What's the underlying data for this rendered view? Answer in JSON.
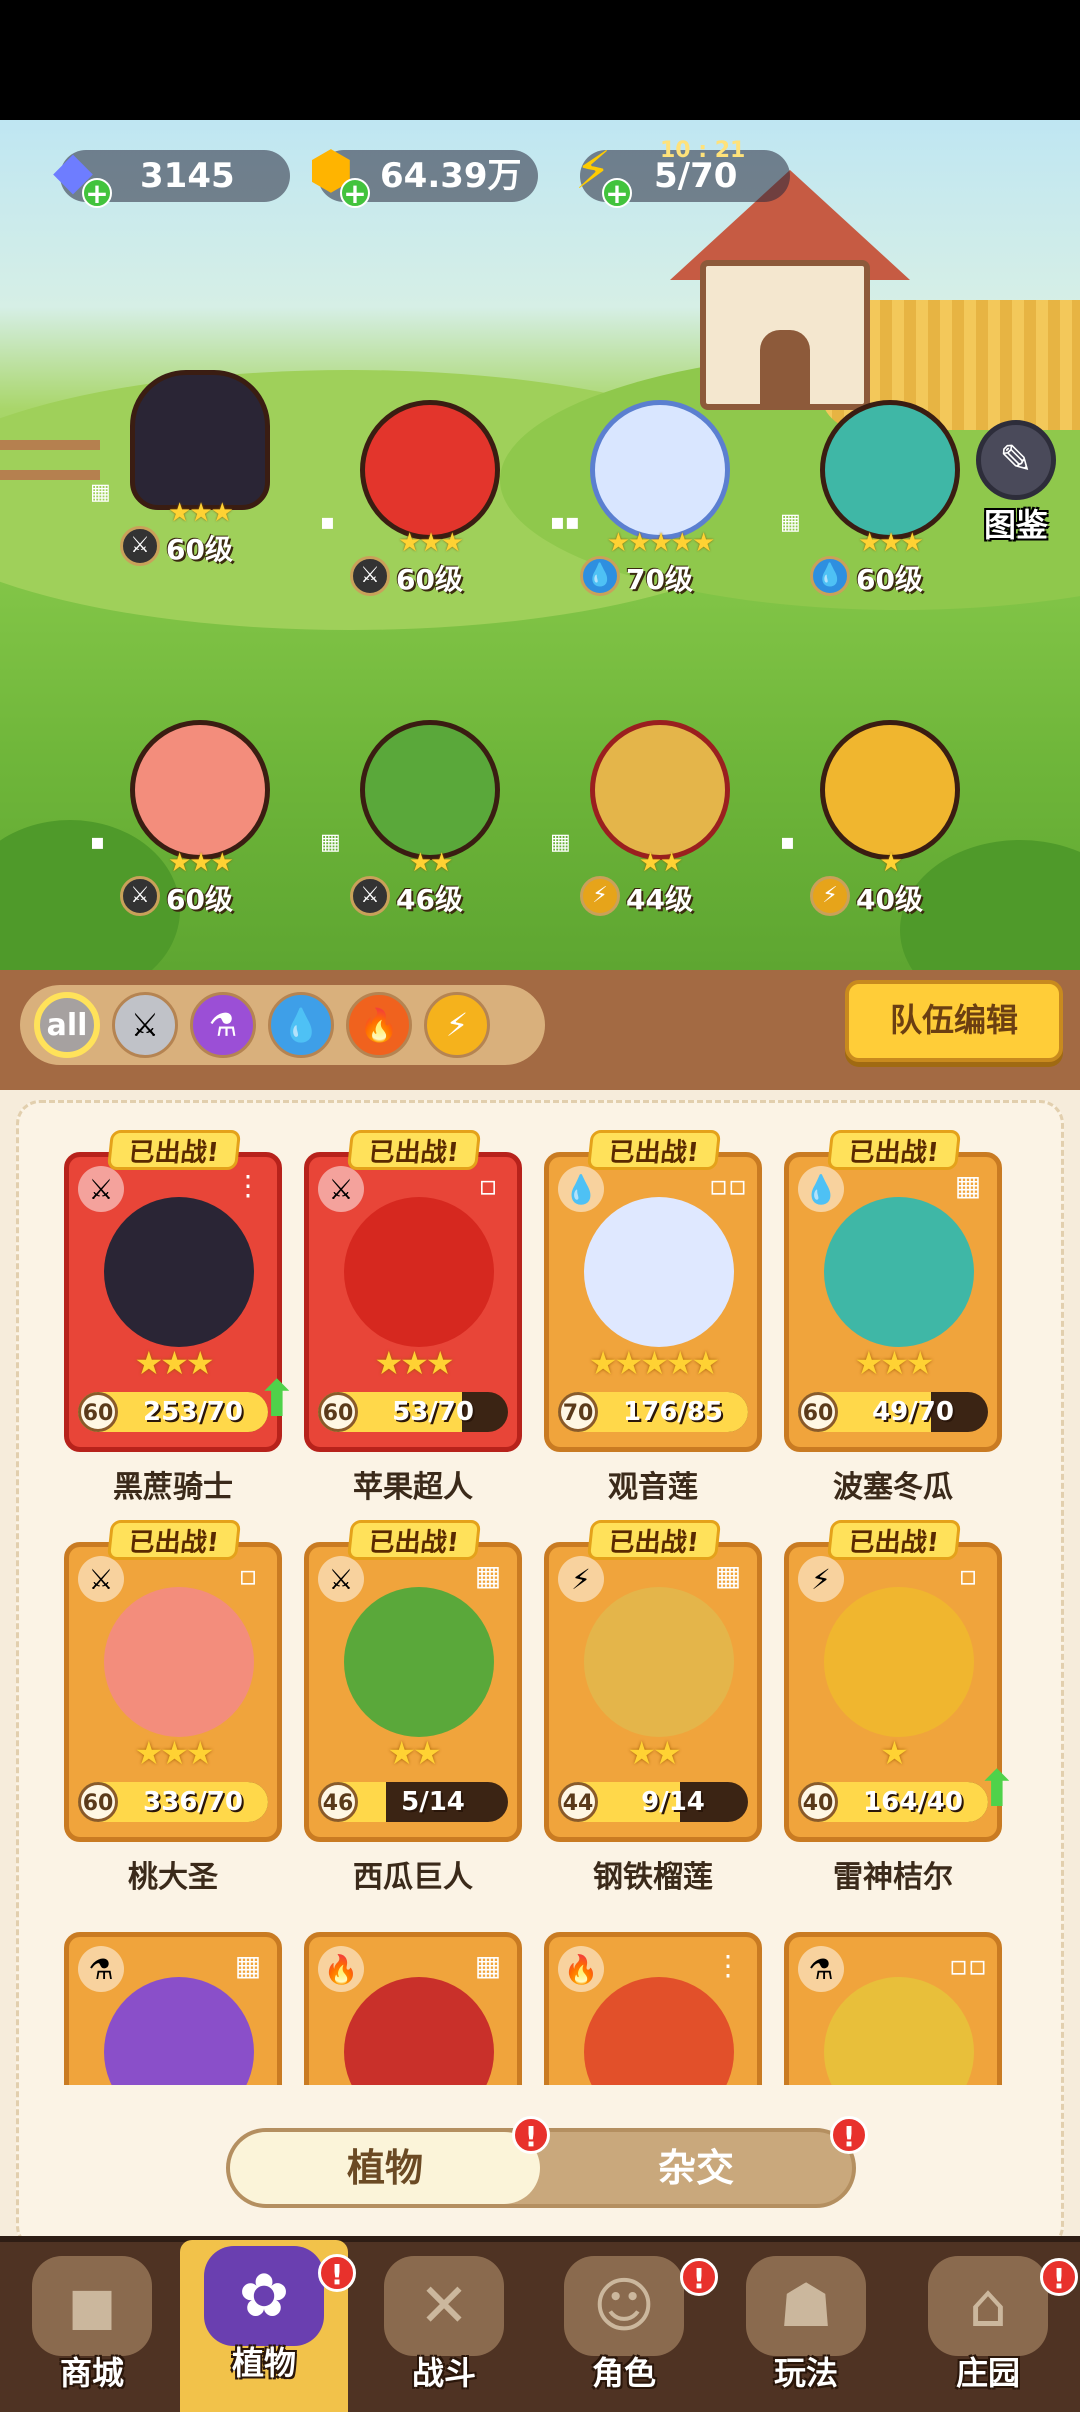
{
  "resources": {
    "gems": "3145",
    "coins": "64.39万",
    "energy": "5/70",
    "energy_timer": "10 : 21"
  },
  "codex_label": "图鉴",
  "field_heroes": [
    {
      "level": "60级",
      "elem": "sword",
      "stars": "★★★"
    },
    {
      "level": "60级",
      "elem": "sword",
      "stars": "★★★"
    },
    {
      "level": "70级",
      "elem": "water",
      "stars": "★★★★★"
    },
    {
      "level": "60级",
      "elem": "water",
      "stars": "★★★"
    },
    {
      "level": "60级",
      "elem": "sword",
      "stars": "★★★"
    },
    {
      "level": "46级",
      "elem": "sword",
      "stars": "★★"
    },
    {
      "level": "44级",
      "elem": "thunder",
      "stars": "★★"
    },
    {
      "level": "40级",
      "elem": "thunder",
      "stars": "★"
    }
  ],
  "filters": [
    "all",
    "sword",
    "poison",
    "water",
    "fire",
    "thunder"
  ],
  "team_edit_label": "队伍编辑",
  "deployed_label": "已出战!",
  "cards": [
    {
      "name": "黑蔗骑士",
      "level": "60",
      "progress": "253/70",
      "stars": "★★★",
      "elem": "sword",
      "upgrade": true
    },
    {
      "name": "苹果超人",
      "level": "60",
      "progress": "53/70",
      "stars": "★★★",
      "elem": "sword",
      "upgrade": false
    },
    {
      "name": "观音莲",
      "level": "70",
      "progress": "176/85",
      "stars": "★★★★★",
      "elem": "water",
      "upgrade": false
    },
    {
      "name": "波塞冬瓜",
      "level": "60",
      "progress": "49/70",
      "stars": "★★★",
      "elem": "water",
      "upgrade": false
    },
    {
      "name": "桃大圣",
      "level": "60",
      "progress": "336/70",
      "stars": "★★★",
      "elem": "sword",
      "upgrade": false
    },
    {
      "name": "西瓜巨人",
      "level": "46",
      "progress": "5/14",
      "stars": "★★",
      "elem": "sword",
      "upgrade": false
    },
    {
      "name": "钢铁榴莲",
      "level": "44",
      "progress": "9/14",
      "stars": "★★",
      "elem": "thunder",
      "upgrade": false
    },
    {
      "name": "雷神桔尔",
      "level": "40",
      "progress": "164/40",
      "stars": "★",
      "elem": "thunder",
      "upgrade": true
    }
  ],
  "tabs": {
    "plants": "植物",
    "hybrid": "杂交"
  },
  "nav": [
    "商城",
    "植物",
    "战斗",
    "角色",
    "玩法",
    "庄园"
  ],
  "colors": {
    "accent": "#ffcd38",
    "card_red": "#e84538",
    "card_orange": "#f0a43c",
    "nav_bg": "#4f3323"
  }
}
